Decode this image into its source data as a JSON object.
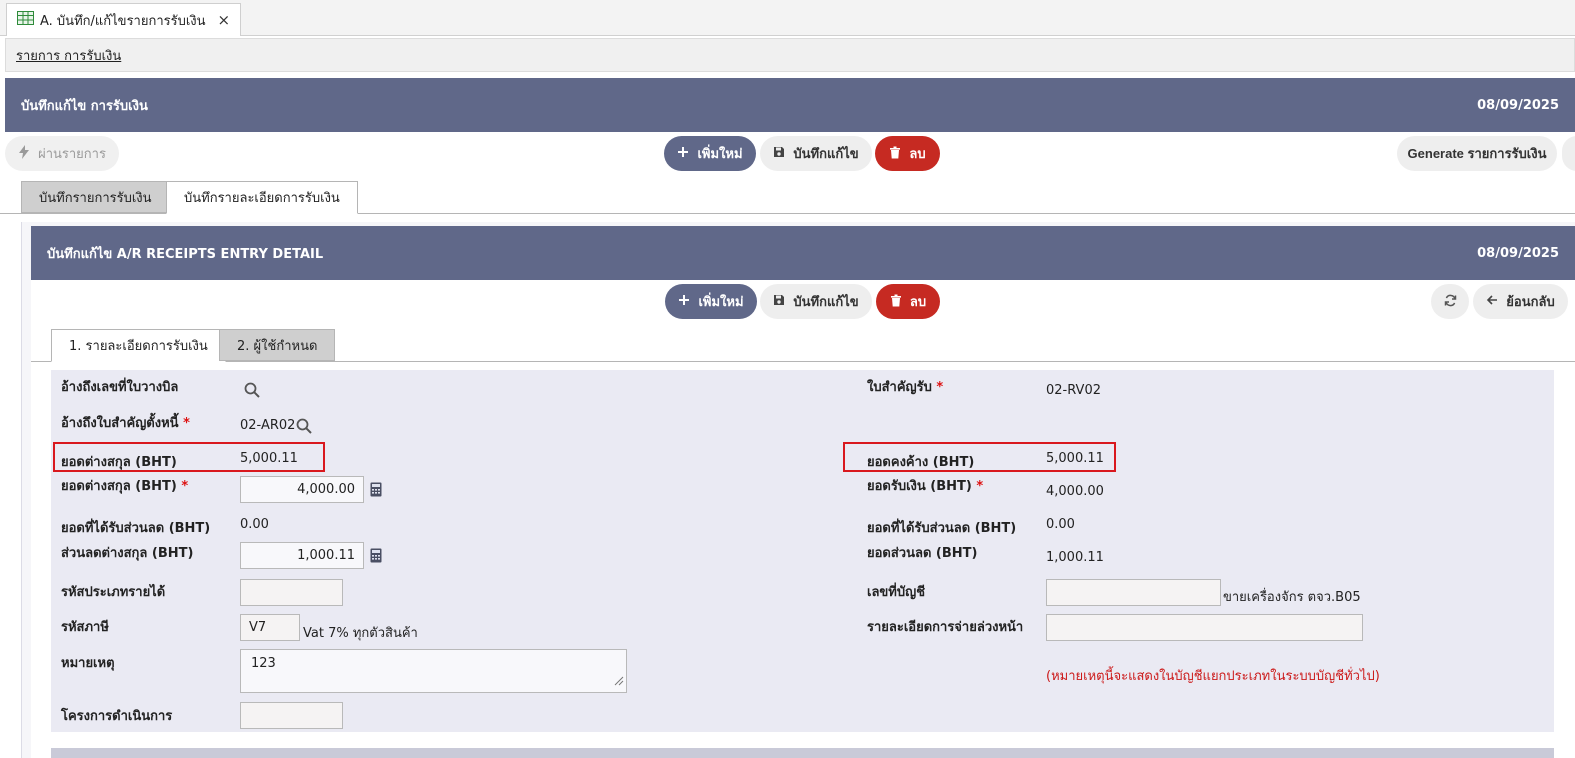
{
  "doc_tab": {
    "icon": "spreadsheet-icon",
    "title": "A. บันทึก/แก้ไขรายการรับเงิน",
    "close": "×"
  },
  "breadcrumb": {
    "link": "รายการ การรับเงิน"
  },
  "main_header": {
    "title": "บันทึกแก้ไข การรับเงิน",
    "date": "08/09/2025"
  },
  "main_toolbar": {
    "post": "ผ่านรายการ",
    "add": "เพิ่มใหม่",
    "save": "บันทึกแก้ไข",
    "delete": "ลบ",
    "generate": "Generate รายการรับเงิน"
  },
  "main_tabs": [
    {
      "label": "บันทึกรายการรับเงิน",
      "active": false
    },
    {
      "label": "บันทึกรายละเอียดการรับเงิน",
      "active": true
    }
  ],
  "detail_header": {
    "title": "บันทึกแก้ไข A/R RECEIPTS ENTRY DETAIL",
    "date": "08/09/2025"
  },
  "detail_toolbar": {
    "add": "เพิ่มใหม่",
    "save": "บันทึกแก้ไข",
    "delete": "ลบ",
    "back": "ย้อนกลับ"
  },
  "detail_tabs": [
    {
      "label": "1. รายละเอียดการรับเงิน",
      "active": true
    },
    {
      "label": "2. ผู้ใช้กำหนด",
      "active": false
    }
  ],
  "form": {
    "ref_billing": {
      "label": "อ้างถึงเลขที่ใบวางบิล"
    },
    "ref_debt_doc": {
      "label": "อ้างถึงใบสำคัญตั้งหนี้",
      "value": "02-AR02"
    },
    "foreign_amount": {
      "label": "ยอดต่างสกุล (BHT)",
      "value": "5,000.11"
    },
    "foreign_amount_input": {
      "label": "ยอดต่างสกุล (BHT)",
      "value": "4,000.00"
    },
    "discount_received": {
      "label": "ยอดที่ได้รับส่วนลด (BHT)",
      "value": "0.00"
    },
    "foreign_discount": {
      "label": "ส่วนลดต่างสกุล (BHT)",
      "value": "1,000.11"
    },
    "income_type": {
      "label": "รหัสประเภทรายได้",
      "value": ""
    },
    "tax_code": {
      "label": "รหัสภาษี",
      "value": "V7",
      "desc": "Vat 7% ทุกตัวสินค้า"
    },
    "remark": {
      "label": "หมายเหตุ",
      "value": "123"
    },
    "project": {
      "label": "โครงการดำเนินการ",
      "value": ""
    },
    "receipt_voucher": {
      "label": "ใบสำคัญรับ",
      "value": "02-RV02"
    },
    "outstanding": {
      "label": "ยอดคงค้าง (BHT)",
      "value": "5,000.11"
    },
    "received_amount": {
      "label": "ยอดรับเงิน (BHT)",
      "value": "4,000.00"
    },
    "discount_received_r": {
      "label": "ยอดที่ได้รับส่วนลด (BHT)",
      "value": "0.00"
    },
    "discount_amount": {
      "label": "ยอดส่วนลด (BHT)",
      "value": "1,000.11"
    },
    "account_no": {
      "label": "เลขที่บัญชี",
      "value": "",
      "desc": "ขายเครื่องจักร ตจว.B05"
    },
    "advance_detail": {
      "label": "รายละเอียดการจ่ายล่วงหน้า",
      "value": ""
    },
    "note": "(หมายเหตุนี้จะแสดงในบัญชีแยกประเภทในระบบบัญชีทั่วไป)",
    "required_mark": "*"
  },
  "colors": {
    "header": "#606889",
    "danger": "#c62a22",
    "highlight": "#d9181e",
    "panel": "#eaeaf3"
  }
}
